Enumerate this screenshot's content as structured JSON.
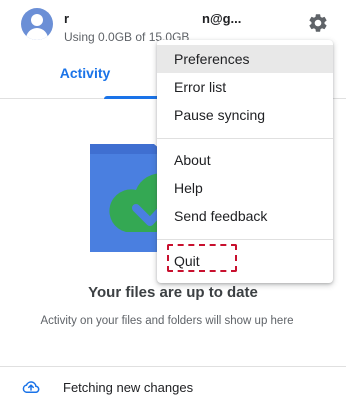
{
  "header": {
    "account_name": "r",
    "account_email": "n@g...",
    "usage_text": "Using 0.0GB of 15.0GB",
    "settings_icon": "gear-icon",
    "avatar_icon": "account-avatar"
  },
  "tabs": [
    {
      "label": "Activity",
      "active": true
    }
  ],
  "status": {
    "title": "Your files are up to date",
    "subtitle": "Activity on your files and folders will show up here",
    "illustration_icon": "synced-folder-icon"
  },
  "footer": {
    "icon": "cloud-upload-icon",
    "text": "Fetching new changes"
  },
  "menu": {
    "items": [
      {
        "label": "Preferences",
        "highlighted": true
      },
      {
        "label": "Error list"
      },
      {
        "label": "Pause syncing"
      },
      {
        "label": "About"
      },
      {
        "label": "Help"
      },
      {
        "label": "Send feedback"
      },
      {
        "label": "Quit",
        "annotated": true
      }
    ]
  },
  "colors": {
    "accent": "#1a73e8",
    "annotation": "#c8102e",
    "folder_blue": "#4a7fe0",
    "cloud_green": "#34a853"
  }
}
